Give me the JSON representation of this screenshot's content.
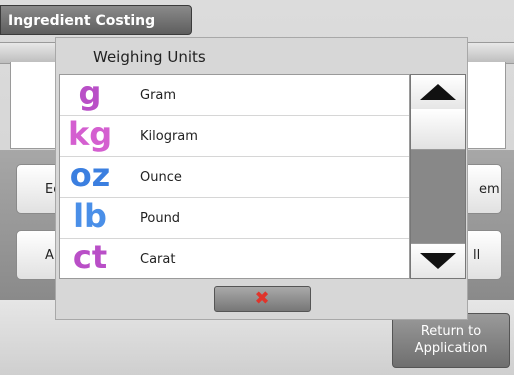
{
  "app": {
    "title": "Ingredient Costing",
    "buttons": [
      {
        "label": "Ec"
      },
      {
        "label": "em"
      },
      {
        "label": "A"
      },
      {
        "label": "ll"
      }
    ],
    "return_button": {
      "line1": "Return to",
      "line2": "Application"
    }
  },
  "modal": {
    "title": "Weighing Units",
    "units": [
      {
        "symbol": "g",
        "label": "Gram",
        "color": "#b94fc7"
      },
      {
        "symbol": "kg",
        "label": "Kilogram",
        "color": "#d45fd0"
      },
      {
        "symbol": "oz",
        "label": "Ounce",
        "color": "#3b7fe0"
      },
      {
        "symbol": "lb",
        "label": "Pound",
        "color": "#4a8fe8"
      },
      {
        "symbol": "ct",
        "label": "Carat",
        "color": "#b94fc7"
      }
    ],
    "scroll": {
      "up_icon": "triangle-up-icon",
      "down_icon": "triangle-down-icon"
    },
    "cancel_icon": "close-x-icon",
    "cancel_glyph": "✖"
  }
}
